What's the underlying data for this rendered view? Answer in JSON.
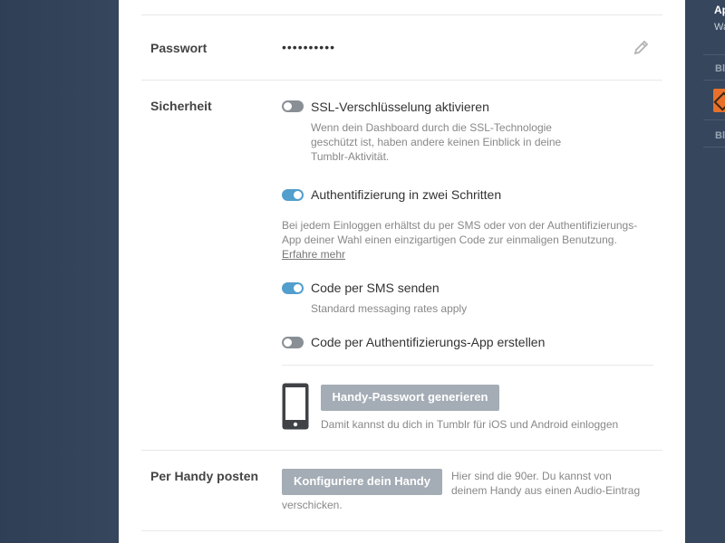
{
  "password": {
    "label": "Passwort",
    "value": "••••••••••",
    "edit_icon": "pencil-icon"
  },
  "security": {
    "label": "Sicherheit",
    "ssl": {
      "label": "SSL-Verschlüsselung aktivieren",
      "enabled": false,
      "desc_line1": "Wenn dein Dashboard durch die SSL-Technologie",
      "desc_line2": "geschützt ist, haben andere keinen Einblick in deine",
      "desc_line3": "Tumblr-Aktivität."
    },
    "two_factor": {
      "label": "Authentifizierung in zwei Schritten",
      "enabled": true,
      "desc_line1": "Bei jedem Einloggen erhältst du per SMS oder von der Authentifizierungs-",
      "desc_line2": "App deiner Wahl einen einzigartigen Code zur einmaligen Benutzung.",
      "learn_more": "Erfahre mehr"
    },
    "sms": {
      "label": "Code per SMS senden",
      "enabled": true,
      "desc": "Standard messaging rates apply"
    },
    "auth_app": {
      "label": "Code per Authentifizierungs-App erstellen",
      "enabled": false
    },
    "mobile_password": {
      "button": "Handy-Passwort generieren",
      "desc": "Damit kannst du dich in Tumblr für iOS und Android einloggen",
      "icon": "phone-icon"
    }
  },
  "mobile_post": {
    "label": "Per Handy posten",
    "button": "Konfiguriere dein Handy",
    "desc_line1": "Hier sind die 90er. Du kannst von",
    "desc_line2": "deinem Handy aus einen Audio-Eintrag",
    "desc_line3": "verschicken."
  },
  "right_rail": {
    "title": "Ap",
    "subtitle": "Wa",
    "section1": "Bl",
    "section2": "Bl"
  },
  "colors": {
    "background": "#36465d",
    "toggle_on": "#529ecc",
    "toggle_off": "#8a8f96",
    "button": "#a4acb5"
  }
}
